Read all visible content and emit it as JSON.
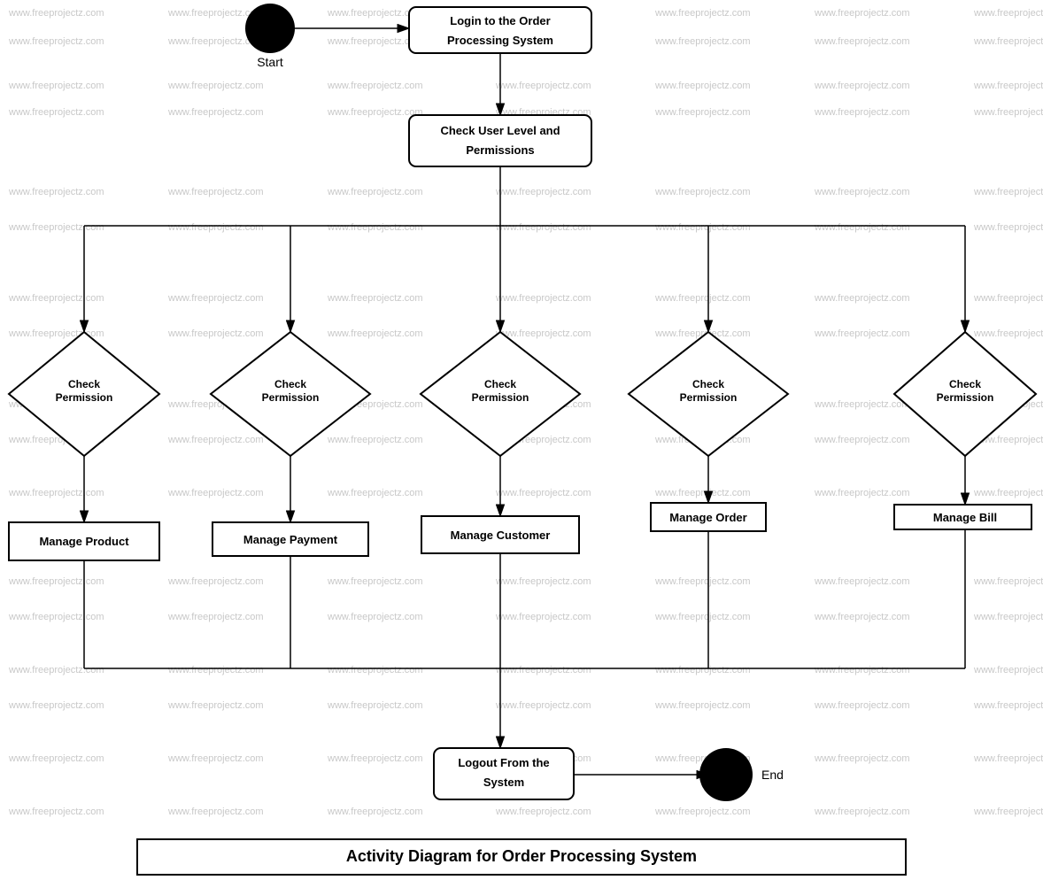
{
  "diagram": {
    "title": "Activity Diagram for Order Processing System",
    "nodes": {
      "start": {
        "label": "Start",
        "type": "circle"
      },
      "login": {
        "label": "Login to the Order Processing System",
        "type": "rounded-rect"
      },
      "check_user": {
        "label": "Check User Level and Permissions",
        "type": "rounded-rect"
      },
      "check_perm_1": {
        "label": "Check Permission",
        "type": "diamond"
      },
      "check_perm_2": {
        "label": "Check Permission",
        "type": "diamond"
      },
      "check_perm_3": {
        "label": "Check Permission",
        "type": "diamond"
      },
      "check_perm_4": {
        "label": "Check Permission",
        "type": "diamond"
      },
      "check_perm_5": {
        "label": "Check Permission",
        "type": "diamond"
      },
      "manage_product": {
        "label": "Manage Product",
        "type": "rect"
      },
      "manage_payment": {
        "label": "Manage Payment",
        "type": "rect"
      },
      "manage_customer": {
        "label": "Manage Customer",
        "type": "rect"
      },
      "manage_order": {
        "label": "Manage Order",
        "type": "rect"
      },
      "manage_bill": {
        "label": "Manage Bill",
        "type": "rect"
      },
      "logout": {
        "label": "Logout From the System",
        "type": "rounded-rect"
      },
      "end": {
        "label": "End",
        "type": "circle"
      }
    },
    "watermark": "www.freeprojectz.com"
  }
}
